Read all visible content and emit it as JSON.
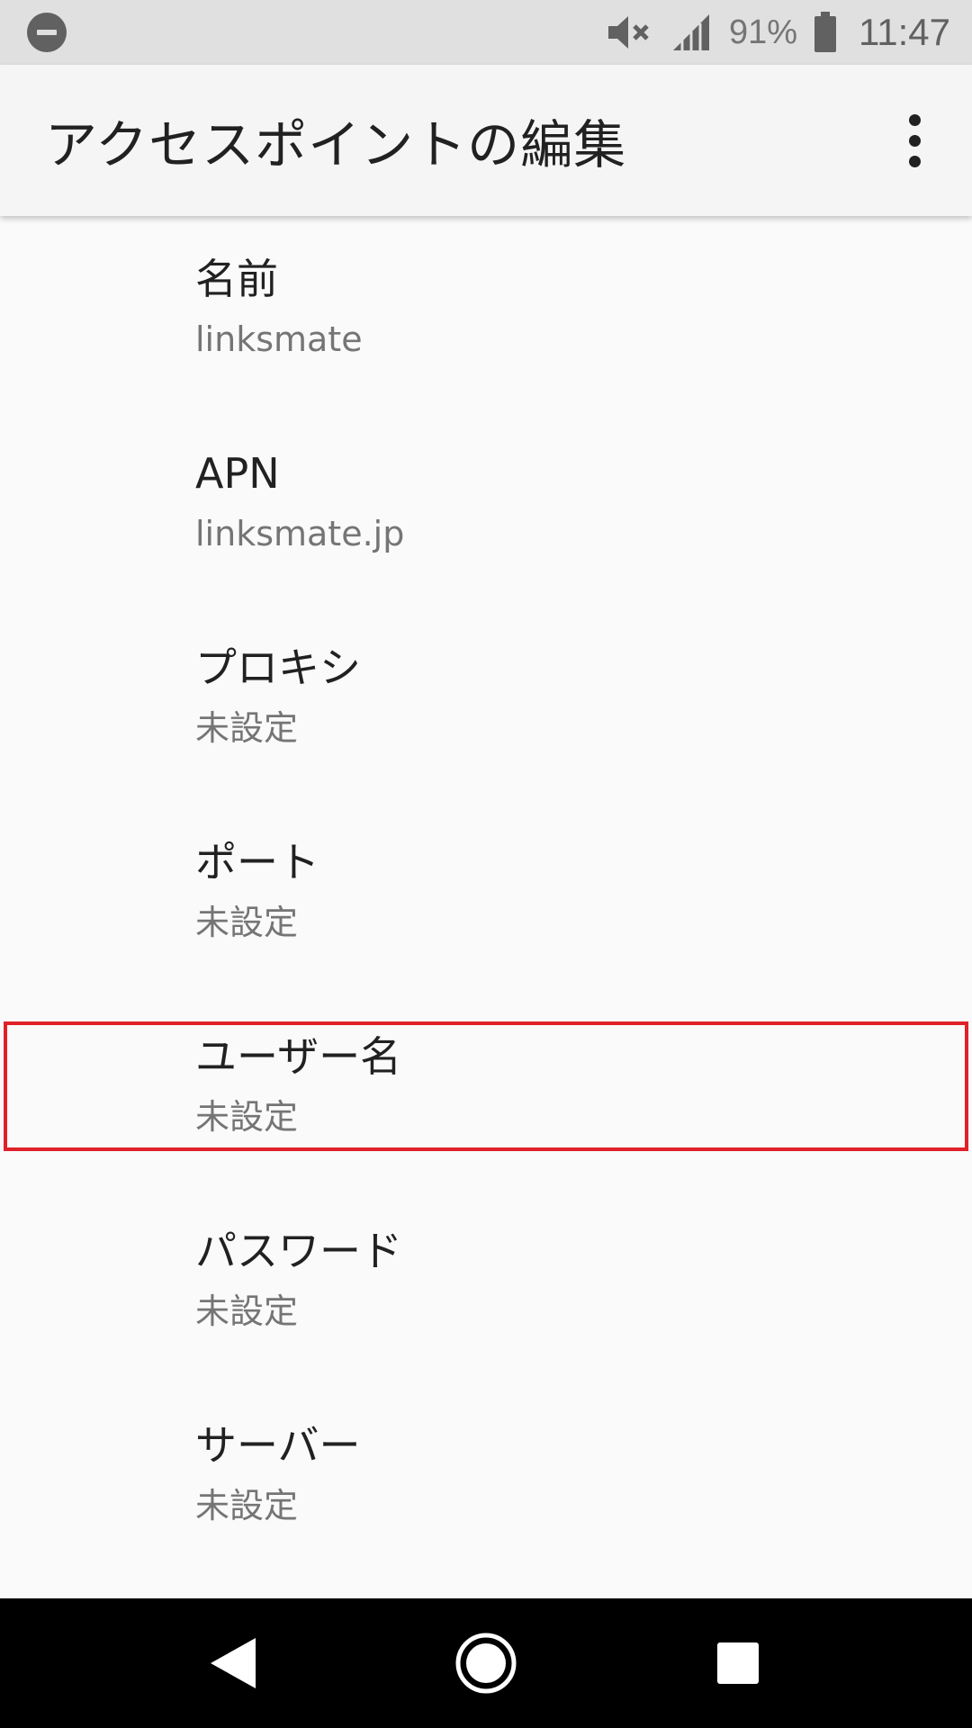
{
  "status_bar": {
    "battery_percent": "91%",
    "time": "11:47",
    "icons": [
      "do-not-disturb-icon",
      "mute-icon",
      "signal-icon",
      "battery-icon"
    ]
  },
  "app_bar": {
    "title": "アクセスポイントの編集",
    "overflow_icon": "more-vert-icon"
  },
  "settings": {
    "items": [
      {
        "title": "名前",
        "summary": "linksmate"
      },
      {
        "title": "APN",
        "summary": "linksmate.jp"
      },
      {
        "title": "プロキシ",
        "summary": "未設定"
      },
      {
        "title": "ポート",
        "summary": "未設定"
      },
      {
        "title": "ユーザー名",
        "summary": "未設定"
      },
      {
        "title": "パスワード",
        "summary": "未設定"
      },
      {
        "title": "サーバー",
        "summary": "未設定"
      }
    ]
  },
  "highlight": {
    "color": "#e02129",
    "target": "ユーザー名"
  },
  "nav_bar": {
    "icons": [
      "back-icon",
      "home-icon",
      "recents-icon"
    ]
  },
  "colors": {
    "status_bar_bg": "#e0e0e0",
    "app_bar_bg": "#f5f5f5",
    "list_bg": "#fafafa",
    "title_text": "#212121",
    "summary_text": "#757575",
    "nav_bar_bg": "#000000"
  }
}
